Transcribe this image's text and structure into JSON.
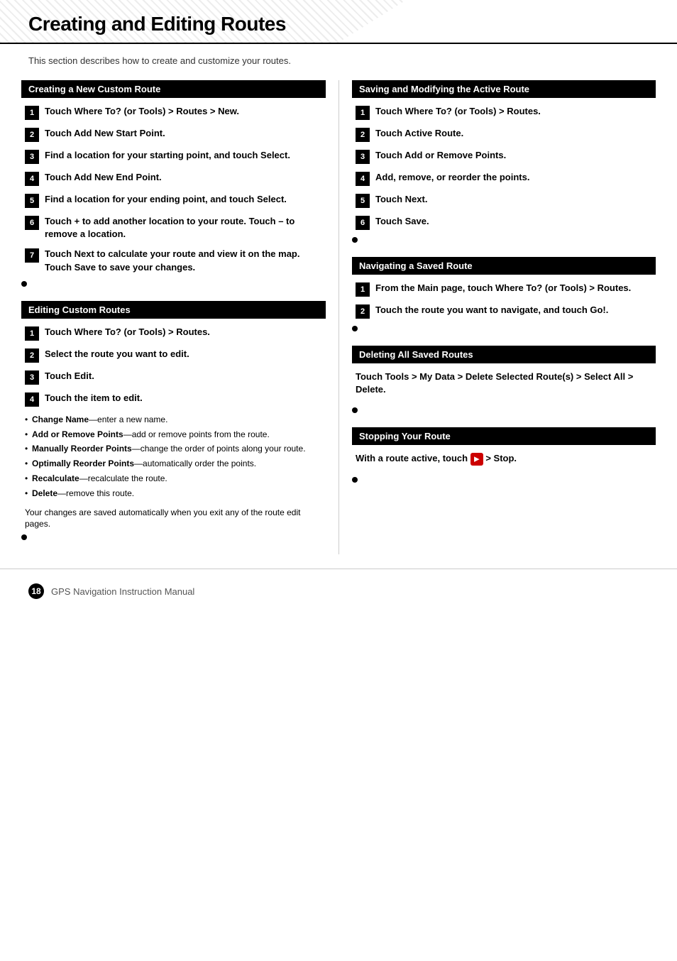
{
  "header": {
    "title": "Creating and Editing Routes"
  },
  "intro": {
    "text": "This section describes how to create and customize your routes."
  },
  "left_col": {
    "sections": [
      {
        "id": "creating-new-custom-route",
        "title": "Creating a New Custom Route",
        "steps": [
          {
            "num": "1",
            "text": "Touch Where To? (or Tools) > Routes > New."
          },
          {
            "num": "2",
            "text": "Touch Add New Start Point."
          },
          {
            "num": "3",
            "text": "Find a location for your starting point, and touch Select."
          },
          {
            "num": "4",
            "text": "Touch Add New End Point."
          },
          {
            "num": "5",
            "text": "Find a location for your ending point, and touch Select."
          },
          {
            "num": "6",
            "text": "Touch + to add another location to your route. Touch – to remove a location."
          },
          {
            "num": "7",
            "text": "Touch Next to calculate your route and view it on the map. Touch Save to save your changes."
          }
        ]
      },
      {
        "id": "editing-custom-routes",
        "title": "Editing Custom Routes",
        "steps": [
          {
            "num": "1",
            "text": "Touch Where To? (or Tools) > Routes."
          },
          {
            "num": "2",
            "text": "Select the route you want to edit."
          },
          {
            "num": "3",
            "text": "Touch Edit."
          },
          {
            "num": "4",
            "text": "Touch the item to edit."
          }
        ],
        "bullets": [
          {
            "label": "Change Name",
            "text": "—enter a new name."
          },
          {
            "label": "Add or Remove Points",
            "text": "—add or remove points from the route."
          },
          {
            "label": "Manually Reorder Points",
            "text": "—change the order of points along your route."
          },
          {
            "label": "Optimally Reorder Points",
            "text": "—automatically order the points."
          },
          {
            "label": "Recalculate",
            "text": "—recalculate the route."
          },
          {
            "label": "Delete",
            "text": "—remove this route."
          }
        ],
        "auto_save": "Your changes are saved automatically when you exit any of the route edit pages."
      }
    ]
  },
  "right_col": {
    "sections": [
      {
        "id": "saving-modifying-active-route",
        "title": "Saving and Modifying the Active Route",
        "steps": [
          {
            "num": "1",
            "text": "Touch Where To? (or Tools) > Routes."
          },
          {
            "num": "2",
            "text": "Touch Active Route."
          },
          {
            "num": "3",
            "text": "Touch Add or Remove Points."
          },
          {
            "num": "4",
            "text": "Add, remove, or reorder the points."
          },
          {
            "num": "5",
            "text": "Touch Next."
          },
          {
            "num": "6",
            "text": "Touch Save."
          }
        ]
      },
      {
        "id": "navigating-saved-route",
        "title": "Navigating a Saved Route",
        "steps": [
          {
            "num": "1",
            "text": "From the Main page, touch Where To? (or Tools) > Routes."
          },
          {
            "num": "2",
            "text": "Touch the route you want to navigate, and touch Go!."
          }
        ]
      },
      {
        "id": "deleting-all-saved-routes",
        "title": "Deleting All Saved Routes",
        "plain": "Touch Tools > My Data > Delete Selected Route(s) > Select All > Delete."
      },
      {
        "id": "stopping-your-route",
        "title": "Stopping Your Route",
        "plain_with_icon": "With a route active, touch",
        "plain_after_icon": "> Stop."
      }
    ]
  },
  "footer": {
    "page_number": "18",
    "text": "GPS Navigation Instruction Manual"
  }
}
